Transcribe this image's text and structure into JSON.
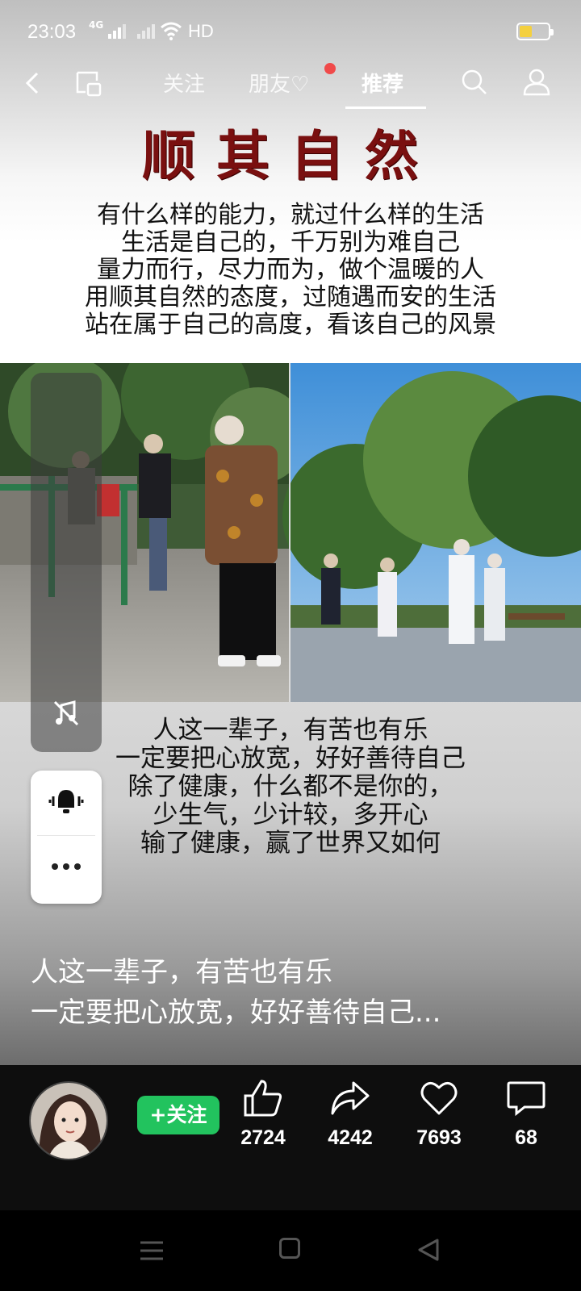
{
  "status_bar": {
    "time": "23:03",
    "network": "4G",
    "hd": "HD",
    "battery_level": 0.45
  },
  "nav": {
    "tabs": [
      {
        "label": "关注"
      },
      {
        "label": "朋友♡"
      },
      {
        "label": "推荐"
      }
    ],
    "active_tab": "推荐"
  },
  "post": {
    "title": "顺其自然",
    "top_lines": [
      "有什么样的能力，就过什么样的生活",
      "生活是自己的，千万别为难自己",
      "量力而行，尽力而为，做个温暖的人",
      "用顺其自然的态度，过随遇而安的生活",
      "站在属于自己的高度，看该自己的风景"
    ],
    "bottom_lines": [
      "人这一辈子，有苦也有乐",
      "一定要把心放宽，好好善待自己",
      "除了健康，什么都不是你的，",
      "少生气，少计较，多开心",
      "输了健康，赢了世界又如何"
    ],
    "caption_lines": [
      "人这一辈子，有苦也有乐",
      "一定要把心放宽，好好善待自己..."
    ]
  },
  "actions": {
    "follow_label": "+关注",
    "likes": "2724",
    "shares": "4242",
    "favorites": "7693",
    "comments": "68"
  },
  "colors": {
    "title_red": "#7a1010",
    "follow_green": "#22c35e",
    "notification_dot": "#f04a4a",
    "battery": "#f4d03f"
  }
}
